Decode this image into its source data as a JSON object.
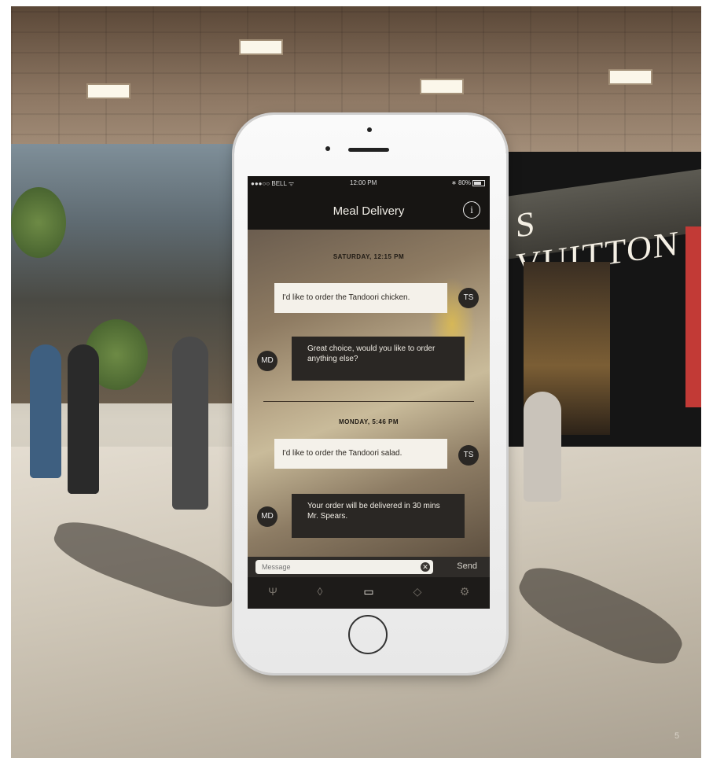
{
  "phone": {
    "status": {
      "carrier": "●●●○○ BELL ᯤ",
      "time": "12:00 PM",
      "battery": "∗ 80%"
    },
    "app": {
      "title": "Meal Delivery",
      "info_icon": "i"
    },
    "chat": {
      "date1": "SATURDAY, 12:15 PM",
      "msg1": "I'd like to order the Tandoori chicken.",
      "user_initials": "TS",
      "reply1": "Great choice, would you like to order anything else?",
      "bot_initials": "MD",
      "date2": "MONDAY, 5:46 PM",
      "msg2": "I'd like to order the Tandoori salad.",
      "reply2": "Your order will be delivered in 30 mins Mr. Spears."
    },
    "composer": {
      "placeholder": "Message",
      "clear": "✕",
      "send": "Send"
    },
    "tabs": [
      {
        "icon": "fork-knife-icon",
        "glyph": "Ψ"
      },
      {
        "icon": "tag-icon",
        "glyph": "◊"
      },
      {
        "icon": "chat-icon",
        "glyph": "▭"
      },
      {
        "icon": "coupon-icon",
        "glyph": "◇"
      },
      {
        "icon": "settings-icon",
        "glyph": "⚙"
      }
    ]
  },
  "background": {
    "store_sign": "S VUITTON"
  },
  "page_number": "5"
}
